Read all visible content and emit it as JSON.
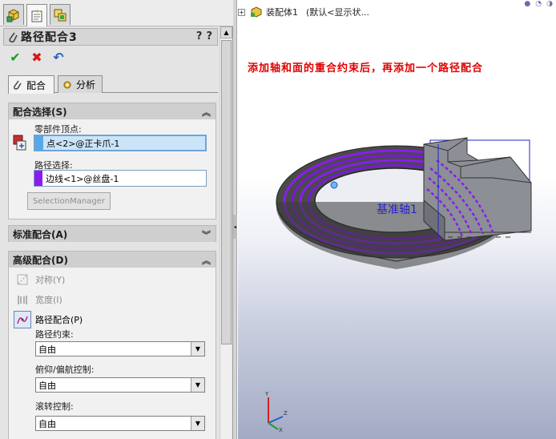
{
  "top_tabs": [
    {
      "name": "feature-manager-tab",
      "icon": "feature-tree-icon",
      "active": false
    },
    {
      "name": "property-manager-tab",
      "icon": "property-manager-icon",
      "active": true
    },
    {
      "name": "configuration-manager-tab",
      "icon": "configuration-icon",
      "active": false
    }
  ],
  "property_manager": {
    "title": "路径配合3",
    "help_icons": [
      "?",
      "?"
    ]
  },
  "actions": {
    "ok": "✔",
    "cancel": "✖",
    "undo": "↶"
  },
  "sub_tabs": [
    {
      "label": "配合",
      "icon": "paperclip-icon"
    },
    {
      "label": "分析",
      "icon": "analysis-icon"
    }
  ],
  "mate_selection": {
    "header": "配合选择(S)",
    "component_vertex_label": "零部件顶点:",
    "component_vertex_value": "点<2>@正卡爪-1",
    "component_vertex_color": "#57a8e8",
    "path_selection_label": "路径选择:",
    "path_selection_value": "边线<1>@丝盘-1",
    "path_selection_color": "#8a1cf0",
    "selection_manager": "SelectionManager"
  },
  "standard_mates": {
    "header": "标准配合(A)"
  },
  "advanced_mates": {
    "header": "高级配合(D)",
    "symmetric": "对称(Y)",
    "width": "宽度(I)",
    "path_mate": "路径配合(P)",
    "path_constraint_label": "路径约束:",
    "path_constraint_value": "自由",
    "pitch_yaw_label": "俯仰/偏航控制:",
    "pitch_yaw_value": "自由",
    "roll_label": "滚转控制:",
    "roll_value": "自由"
  },
  "viewport": {
    "tree_expand": "+",
    "tree_label": "装配体1",
    "tree_config": "(默认<显示状...",
    "annotation": "添加轴和面的重合约束后，再添加一个路径配合",
    "axis_label": "基准轴1",
    "triad_labels": {
      "x": "X",
      "y": "Y",
      "z": "Z"
    }
  },
  "colors": {
    "annotation_red": "#e00000",
    "axis_blue": "#2525c8",
    "path_purple": "#8a1cf0",
    "part_gray": "#8c8f96"
  }
}
